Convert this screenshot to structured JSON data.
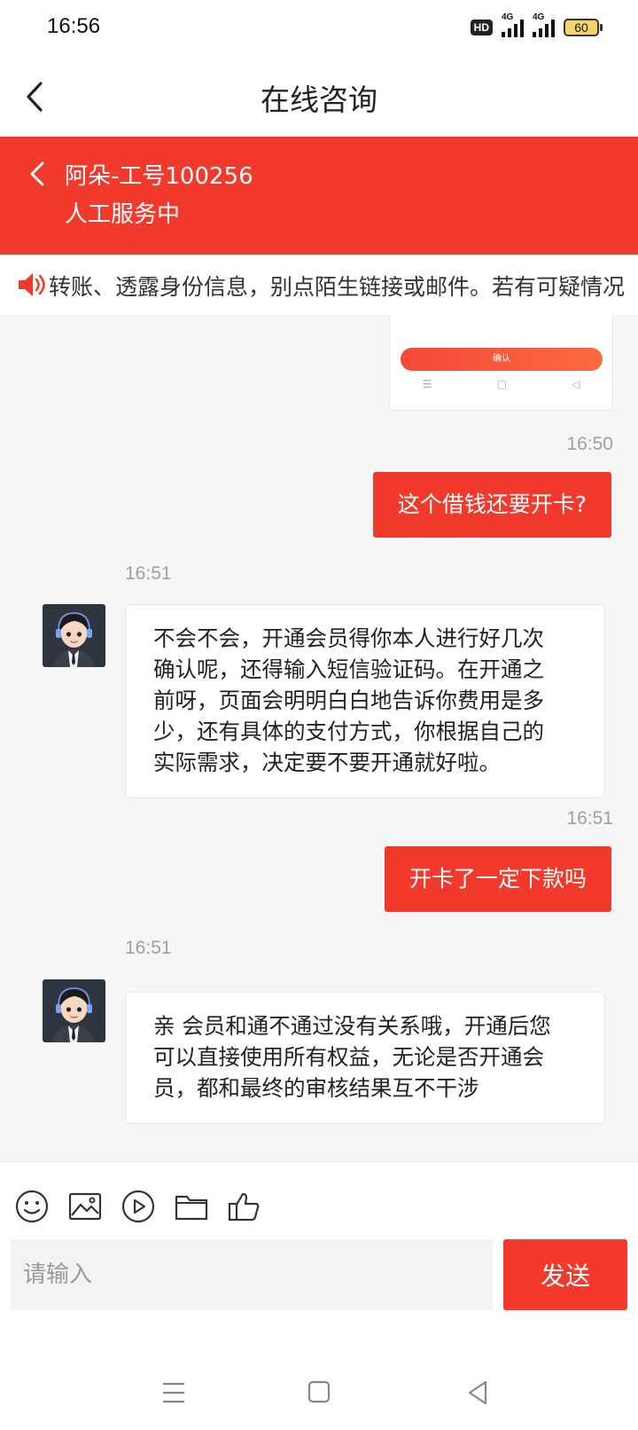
{
  "status_bar": {
    "time": "16:56",
    "hd_label": "HD",
    "network_1": "4G",
    "network_2": "4G",
    "battery": "60"
  },
  "header": {
    "title": "在线咨询"
  },
  "agent_banner": {
    "name": "阿朵-工号100256",
    "status": "人工服务中",
    "background_color": "#f23a2c"
  },
  "notice": {
    "text": "转账、透露身份信息，别点陌生链接或邮件。若有可疑情况"
  },
  "image_card": {
    "confirm_label": "确认"
  },
  "messages": [
    {
      "direction": "out",
      "time": "16:50",
      "text": "这个借钱还要开卡?"
    },
    {
      "direction": "in",
      "time": "16:51",
      "lines": [
        "不会不会，开通会员得你本人进行好几次",
        "确认呢，还得输入短信验证码。在开通之",
        "前呀，页面会明明白白地告诉你费用是多",
        "少，还有具体的支付方式，你根据自己的",
        "实际需求，决定要不要开通就好啦。"
      ]
    },
    {
      "direction": "out",
      "time": "16:51",
      "text": "开卡了一定下款吗"
    },
    {
      "direction": "in",
      "time": "16:51",
      "lines": [
        "亲 会员和通不通过没有关系哦，开通后您",
        "可以直接使用所有权益，无论是否开通会",
        "员，都和最终的审核结果互不干涉"
      ]
    }
  ],
  "toolbar": {
    "icons": [
      "emoji-icon",
      "image-icon",
      "video-icon",
      "folder-icon",
      "thumbs-up-icon"
    ]
  },
  "input": {
    "placeholder": "请输入",
    "send_label": "发送"
  },
  "accent_color": "#f23a2c"
}
